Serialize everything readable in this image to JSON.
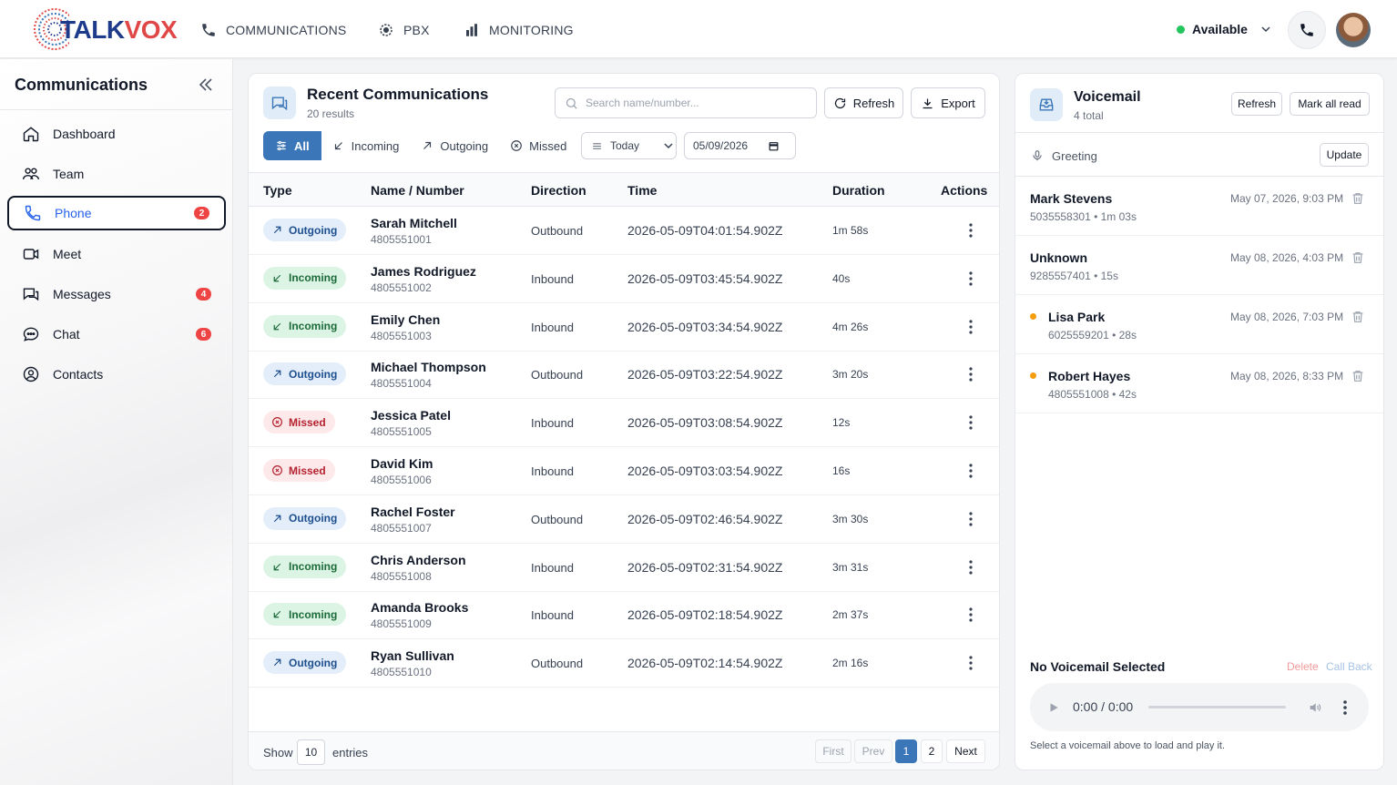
{
  "brand": {
    "name_part1": "TALK",
    "name_part2": "VOX"
  },
  "nav": {
    "items": [
      {
        "label": "COMMUNICATIONS"
      },
      {
        "label": "PBX"
      },
      {
        "label": "MONITORING"
      }
    ],
    "status_label": "Available"
  },
  "sidebar": {
    "title": "Communications",
    "items": [
      {
        "label": "Dashboard",
        "icon": "home-icon"
      },
      {
        "label": "Team",
        "icon": "team-icon"
      },
      {
        "label": "Phone",
        "icon": "phone-icon",
        "badge": "2",
        "active": true
      },
      {
        "label": "Meet",
        "icon": "video-icon"
      },
      {
        "label": "Messages",
        "icon": "messages-icon",
        "badge": "4"
      },
      {
        "label": "Chat",
        "icon": "chat-icon",
        "badge": "6"
      },
      {
        "label": "Contacts",
        "icon": "contacts-icon"
      }
    ]
  },
  "main": {
    "title": "Recent Communications",
    "subtitle": "20 results",
    "search_placeholder": "Search name/number...",
    "refresh_label": "Refresh",
    "export_label": "Export",
    "filters": {
      "all": "All",
      "incoming": "Incoming",
      "outgoing": "Outgoing",
      "missed": "Missed"
    },
    "period_select": "Today",
    "date_value": "05/09/2026",
    "columns": {
      "type": "Type",
      "name": "Name / Number",
      "direction": "Direction",
      "time": "Time",
      "duration": "Duration",
      "actions": "Actions"
    },
    "rows": [
      {
        "type": "Outgoing",
        "name": "Sarah Mitchell",
        "number": "4805551001",
        "direction": "Outbound",
        "time": "2026-05-09T04:01:54.902Z",
        "duration": "1m 58s"
      },
      {
        "type": "Incoming",
        "name": "James Rodriguez",
        "number": "4805551002",
        "direction": "Inbound",
        "time": "2026-05-09T03:45:54.902Z",
        "duration": "40s"
      },
      {
        "type": "Incoming",
        "name": "Emily Chen",
        "number": "4805551003",
        "direction": "Inbound",
        "time": "2026-05-09T03:34:54.902Z",
        "duration": "4m 26s"
      },
      {
        "type": "Outgoing",
        "name": "Michael Thompson",
        "number": "4805551004",
        "direction": "Outbound",
        "time": "2026-05-09T03:22:54.902Z",
        "duration": "3m 20s"
      },
      {
        "type": "Missed",
        "name": "Jessica Patel",
        "number": "4805551005",
        "direction": "Inbound",
        "time": "2026-05-09T03:08:54.902Z",
        "duration": "12s"
      },
      {
        "type": "Missed",
        "name": "David Kim",
        "number": "4805551006",
        "direction": "Inbound",
        "time": "2026-05-09T03:03:54.902Z",
        "duration": "16s"
      },
      {
        "type": "Outgoing",
        "name": "Rachel Foster",
        "number": "4805551007",
        "direction": "Outbound",
        "time": "2026-05-09T02:46:54.902Z",
        "duration": "3m 30s"
      },
      {
        "type": "Incoming",
        "name": "Chris Anderson",
        "number": "4805551008",
        "direction": "Inbound",
        "time": "2026-05-09T02:31:54.902Z",
        "duration": "3m 31s"
      },
      {
        "type": "Incoming",
        "name": "Amanda Brooks",
        "number": "4805551009",
        "direction": "Inbound",
        "time": "2026-05-09T02:18:54.902Z",
        "duration": "2m 37s"
      },
      {
        "type": "Outgoing",
        "name": "Ryan Sullivan",
        "number": "4805551010",
        "direction": "Outbound",
        "time": "2026-05-09T02:14:54.902Z",
        "duration": "2m 16s"
      }
    ],
    "footer": {
      "show_label": "Show",
      "entries_value": "10",
      "entries_label": "entries"
    },
    "pagination": {
      "first": "First",
      "prev": "Prev",
      "pages": [
        "1",
        "2"
      ],
      "current": "1",
      "next": "Next"
    }
  },
  "voicemail": {
    "title": "Voicemail",
    "subtitle": "4 total",
    "refresh_label": "Refresh",
    "mark_all_label": "Mark all read",
    "greeting_label": "Greeting",
    "update_label": "Update",
    "items": [
      {
        "name": "Mark Stevens",
        "meta": "5035558301 • 1m 03s",
        "date": "May 07, 2026, 9:03 PM",
        "unread": false
      },
      {
        "name": "Unknown",
        "meta": "9285557401 • 15s",
        "date": "May 08, 2026, 4:03 PM",
        "unread": false
      },
      {
        "name": "Lisa Park",
        "meta": "6025559201 • 28s",
        "date": "May 08, 2026, 7:03 PM",
        "unread": true
      },
      {
        "name": "Robert Hayes",
        "meta": "4805551008 • 42s",
        "date": "May 08, 2026, 8:33 PM",
        "unread": true
      }
    ],
    "player": {
      "title": "No Voicemail Selected",
      "delete_label": "Delete",
      "callback_label": "Call Back",
      "time": "0:00 / 0:00",
      "hint": "Select a voicemail above to load and play it."
    }
  },
  "colors": {
    "primary": "#3b77b8",
    "badge": "#ef4444",
    "available": "#22c55e",
    "unread": "#f59e0b"
  }
}
